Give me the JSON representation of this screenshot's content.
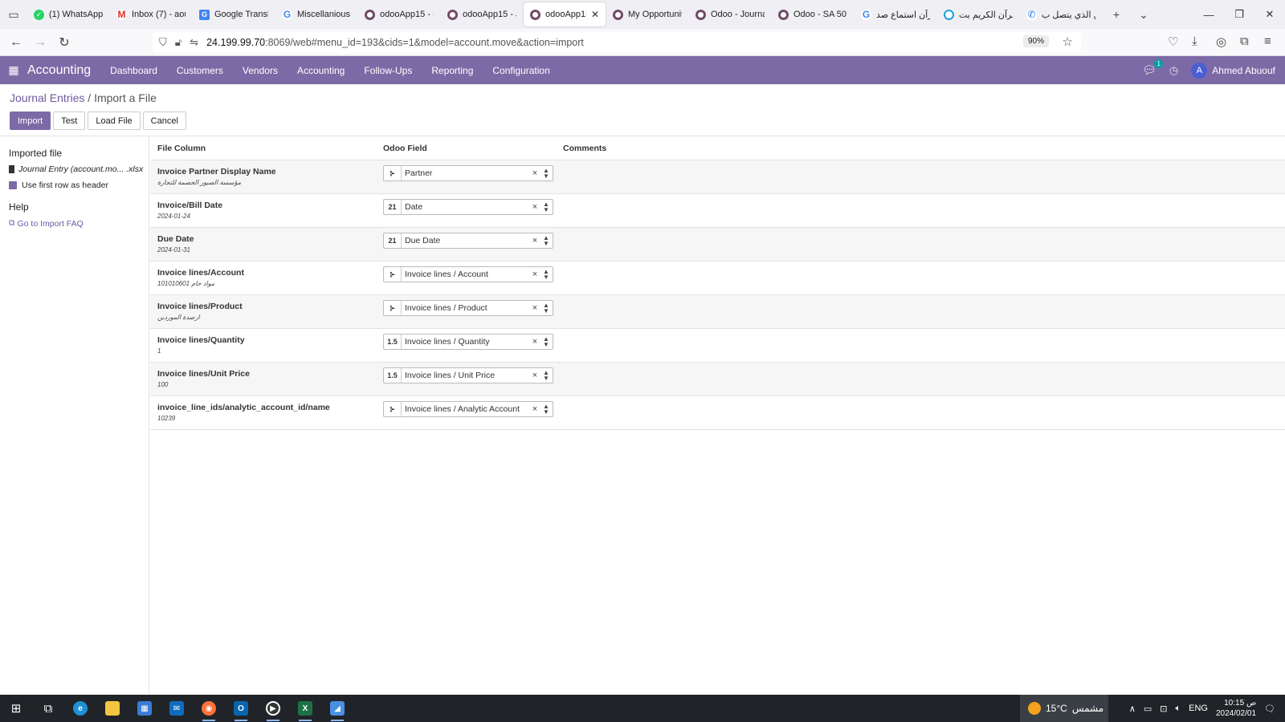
{
  "browser": {
    "tabs": [
      {
        "label": "(1) WhatsApp",
        "icon": "whatsapp-icon",
        "fav": "wa",
        "active": false
      },
      {
        "label": "Inbox (7) - aou",
        "icon": "gmail-icon",
        "fav": "gm",
        "active": false
      },
      {
        "label": "Google Translat",
        "icon": "google-translate-icon",
        "fav": "gt",
        "active": false
      },
      {
        "label": "Miscellanious -",
        "icon": "google-icon",
        "fav": "g",
        "active": false
      },
      {
        "label": "odooApp15 - B",
        "icon": "odoo-icon",
        "fav": "odoo",
        "active": false
      },
      {
        "label": "odooApp15 - Jc",
        "icon": "odoo-icon",
        "fav": "odoo",
        "active": false
      },
      {
        "label": "odooApp15",
        "icon": "odoo-icon",
        "fav": "odoo",
        "active": true
      },
      {
        "label": "My Opportunit",
        "icon": "odoo-icon",
        "fav": "odoo",
        "active": false
      },
      {
        "label": "Odoo - Journal",
        "icon": "odoo-icon",
        "fav": "odoo",
        "active": false
      },
      {
        "label": "Odoo - SA 50 6",
        "icon": "odoo-icon",
        "fav": "odoo",
        "active": false
      },
      {
        "label": "قرآن استماع صد",
        "icon": "google-icon",
        "fav": "g",
        "active": false
      },
      {
        "label": "القرآن الكريم بت",
        "icon": "quran-icon",
        "fav": "q",
        "active": false
      },
      {
        "label": "من الذي يتصل ب",
        "icon": "phone-icon",
        "fav": "ph",
        "active": false
      }
    ],
    "url_host": "24.199.99.70",
    "url_rest": ":8069/web#menu_id=193&cids=1&model=account.move&action=import",
    "zoom": "90%"
  },
  "odoo_nav": {
    "app_name": "Accounting",
    "menu": [
      "Dashboard",
      "Customers",
      "Vendors",
      "Accounting",
      "Follow-Ups",
      "Reporting",
      "Configuration"
    ],
    "chat_badge": "1",
    "user_initial": "A",
    "user_name": "Ahmed Abuouf"
  },
  "breadcrumb": {
    "parent": "Journal Entries",
    "sep": " / ",
    "current": "Import a File"
  },
  "actions": {
    "import": "Import",
    "test": "Test",
    "load_file": "Load File",
    "cancel": "Cancel"
  },
  "sidebar": {
    "imported_file_title": "Imported file",
    "file_name": "Journal Entry (account.mo... .xlsx",
    "first_row_header": "Use first row as header",
    "help_title": "Help",
    "faq_link": "Go to Import FAQ"
  },
  "table": {
    "headers": {
      "file_column": "File Column",
      "odoo_field": "Odoo Field",
      "comments": "Comments"
    },
    "rows": [
      {
        "column": "Invoice Partner Display Name",
        "sample": "مؤسسة الصيور الحصمة للتجارة",
        "type": "relation",
        "field": "Partner"
      },
      {
        "column": "Invoice/Bill Date",
        "sample": "2024-01-24",
        "type": "date",
        "field": "Date"
      },
      {
        "column": "Due Date",
        "sample": "2024-01-31",
        "type": "date",
        "field": "Due Date"
      },
      {
        "column": "Invoice lines/Account",
        "sample": "101010601 مواد خام",
        "type": "relation",
        "field": "Invoice lines / Account"
      },
      {
        "column": "Invoice lines/Product",
        "sample": "ارصدة الموردين",
        "type": "relation",
        "field": "Invoice lines / Product"
      },
      {
        "column": "Invoice lines/Quantity",
        "sample": "1",
        "type": "number",
        "field": "Invoice lines / Quantity"
      },
      {
        "column": "Invoice lines/Unit Price",
        "sample": "100",
        "type": "number",
        "field": "Invoice lines / Unit Price"
      },
      {
        "column": "invoice_line_ids/analytic_account_id/name",
        "sample": "10239",
        "type": "relation",
        "field": "Invoice lines / Analytic Account"
      }
    ]
  },
  "type_glyphs": {
    "relation": "⊱",
    "date": "21",
    "number": "1.5"
  },
  "taskbar": {
    "weather_temp": "15°C",
    "weather_text": "مشمس",
    "lang": "ENG",
    "time": "10:15 ص",
    "date": "2024/02/01",
    "notif_count": "1"
  },
  "colors": {
    "odoo_purple": "#7c6aa6",
    "link": "#6f5aa0"
  }
}
